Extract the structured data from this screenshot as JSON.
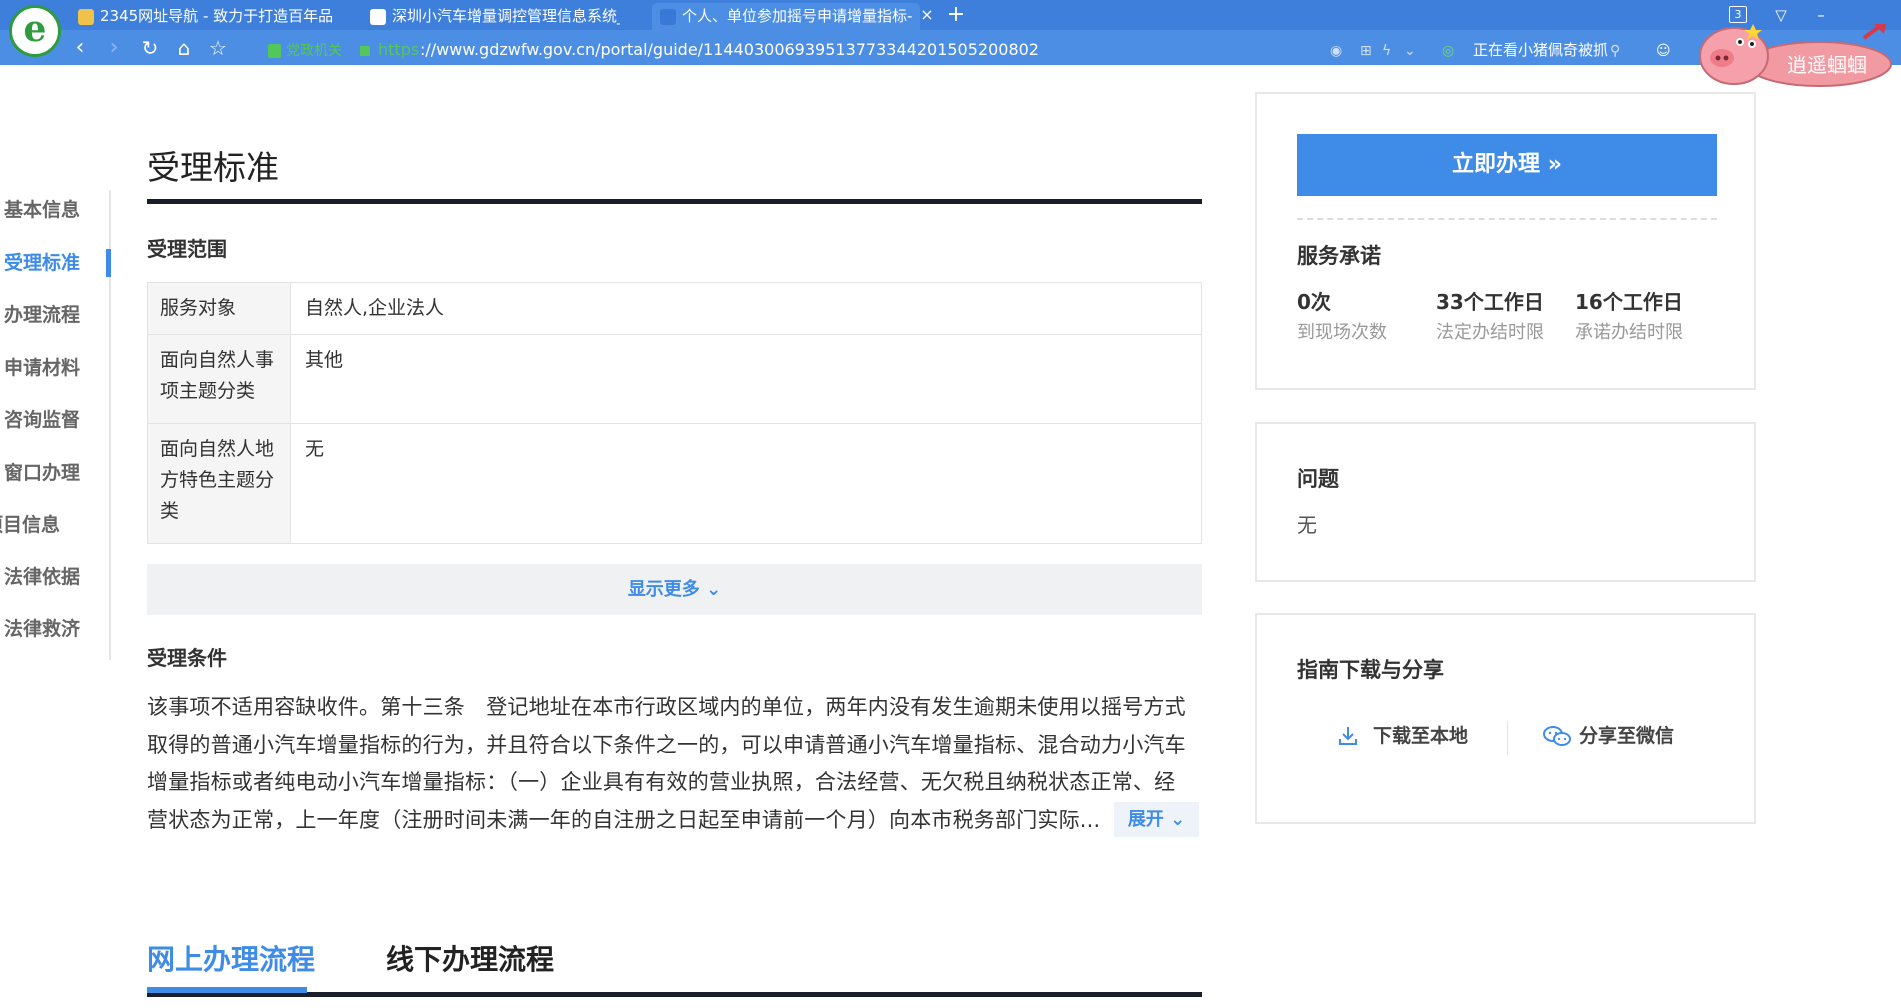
{
  "browser": {
    "logo_letter": "e",
    "tabs": [
      {
        "label": "2345网址导航 - 致力于打造百年品"
      },
      {
        "label": "深圳小汽车增量调控管理信息系统_"
      },
      {
        "label": "个人、单位参加摇号申请增量指标-"
      }
    ],
    "close_glyph": "×",
    "new_tab_glyph": "+",
    "tab_count": "3",
    "url_badge": "党政机关",
    "url_scheme": "https",
    "url_rest": "://www.gdzwfw.gov.cn/portal/guide/11440300693951377334420150520080​2",
    "extension_text": "正在看小猪佩奇被抓",
    "pig_label": "逍遥蝈蝈",
    "colors": {
      "chrome_dark": "#3f7fdc",
      "chrome_light": "#4d8ee5",
      "gov_green": "#52c75a"
    }
  },
  "side_nav": {
    "items": [
      {
        "label": "基本信息"
      },
      {
        "label": "受理标准"
      },
      {
        "label": "办理流程"
      },
      {
        "label": "申请材料"
      },
      {
        "label": "咨询监督"
      },
      {
        "label": "窗口办理"
      },
      {
        "label": "项目信息"
      },
      {
        "label": "法律依据"
      },
      {
        "label": "法律救济"
      }
    ]
  },
  "main": {
    "title": "受理标准",
    "scope_title": "受理范围",
    "table": [
      {
        "key": "服务对象",
        "value": "自然人,企业法人"
      },
      {
        "key": "面向自然人事项主题分类",
        "value": "其他"
      },
      {
        "key": "面向自然人地方特色主题分类",
        "value": "无"
      }
    ],
    "show_more": "显示更多",
    "conditions_title": "受理条件",
    "conditions_text": "该事项不适用容缺收件。第十三条　登记地址在本市行政区域内的单位，两年内没有发生逾期未使用以摇号方式取得的普通小汽车增量指标的行为，并且符合以下条件之一的，可以申请普通小汽车增量指标、混合动力小汽车增量指标或者纯电动小汽车增量指标：（一）企业具有有效的营业执照，合法经营、无欠税且纳税状态正常、经营状态为正常，上一年度（注册时间未满一年的自注册之日起至申请前一个月）向本市税务部门实际...",
    "expand": "展开",
    "flow_tabs": [
      {
        "label": "网上办理流程"
      },
      {
        "label": "线下办理流程"
      }
    ]
  },
  "right": {
    "handle_button": "立即办理",
    "service_title": "服务承诺",
    "stats": [
      {
        "value": "0次",
        "label": "到现场次数"
      },
      {
        "value": "33个工作日",
        "label": "法定办结时限"
      },
      {
        "value": "16个工作日",
        "label": "承诺办结时限"
      }
    ],
    "question_title": "问题",
    "question_value": "无",
    "download_title": "指南下载与分享",
    "download_button": "下载至本地",
    "share_button": "分享至微信",
    "accent_color": "#3e8be8"
  }
}
